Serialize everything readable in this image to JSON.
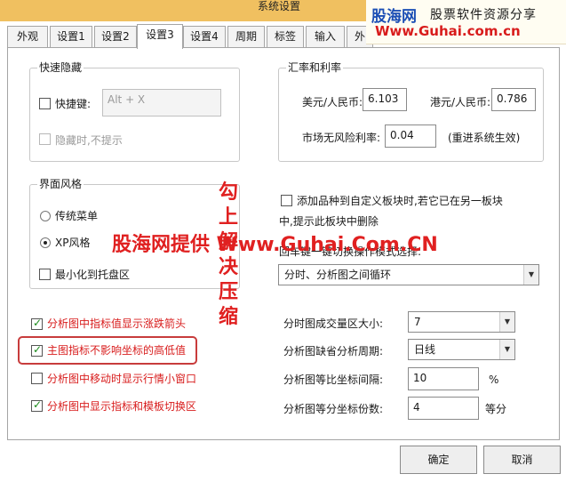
{
  "window": {
    "title": "系统设置"
  },
  "tabs": [
    {
      "label": "外观"
    },
    {
      "label": "设置1"
    },
    {
      "label": "设置2"
    },
    {
      "label": "设置3"
    },
    {
      "label": "设置4"
    },
    {
      "label": "周期"
    },
    {
      "label": "标签"
    },
    {
      "label": "输入"
    },
    {
      "label": "外"
    }
  ],
  "active_tab": "设置3",
  "quick_hide": {
    "title": "快速隐藏",
    "hotkey_label": "快捷键:",
    "hotkey_value": "Alt + X",
    "no_prompt_label": "隐藏时,不提示"
  },
  "rates": {
    "title": "汇率和利率",
    "usd_label": "美元/人民币:",
    "usd_value": "6.103",
    "hkd_label": "港元/人民币:",
    "hkd_value": "0.786",
    "riskfree_label": "市场无风险利率:",
    "riskfree_value": "0.04",
    "restart_note": "(重进系统生效)"
  },
  "style": {
    "title": "界面风格",
    "option_traditional": "传统菜单",
    "option_xp": "XP风格",
    "minimize_tray": "最小化到托盘区"
  },
  "custom_block": {
    "line1": "添加品种到自定义板块时,若它已在另一板块",
    "line2": "中,提示此板块中删除",
    "mode_label": "回车键一键切换操作模式选择:",
    "mode_value": "分时、分析图之间循环"
  },
  "options": [
    {
      "label": "分析图中指标值显示涨跌箭头",
      "checked": true
    },
    {
      "label": "主图指标不影响坐标的高低值",
      "checked": true
    },
    {
      "label": "分析图中移动时显示行情小窗口",
      "checked": false
    },
    {
      "label": "分析图中显示指标和模板切换区",
      "checked": true
    }
  ],
  "chart_settings": {
    "volume_label": "分时图成交量区大小:",
    "volume_value": "7",
    "period_label": "分析图缺省分析周期:",
    "period_value": "日线",
    "ratio_label": "分析图等比坐标间隔:",
    "ratio_value": "10",
    "ratio_unit": "%",
    "div_label": "分析图等分坐标份数:",
    "div_value": "4",
    "div_unit": "等分"
  },
  "buttons": {
    "ok": "确定",
    "cancel": "取消"
  },
  "logo": {
    "name": "股海网",
    "slogan": "股票软件资源分享",
    "url": "Www.Guhai.com.cn"
  },
  "watermark": {
    "text": "股海网提供 Www.Guhai.Com.CN",
    "vertical": "勾上解决压缩"
  },
  "colors": {
    "accent_red": "#d81c1c",
    "highlight_box": "#c83c3c",
    "logo_blue": "#1c4fb5"
  }
}
